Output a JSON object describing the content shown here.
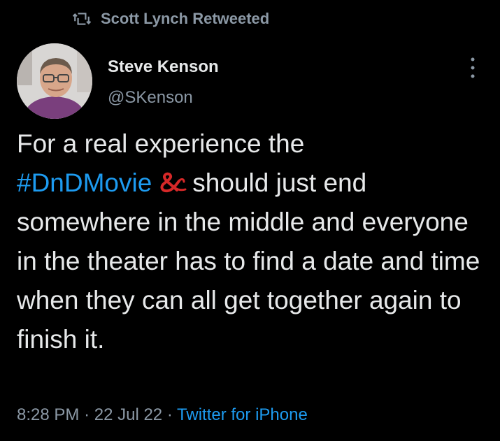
{
  "retweet": {
    "icon": "retweet-icon",
    "label": "Scott Lynch Retweeted"
  },
  "author": {
    "display_name": "Steve Kenson",
    "handle": "@SKenson",
    "avatar_icon": "avatar"
  },
  "menu": {
    "icon": "more-vertical-icon"
  },
  "tweet": {
    "line1": "For a real experience the",
    "hashtag": "#DnDMovie",
    "hashtag_emoji_icon": "dnd-ampersand-icon",
    "after_hashtag": "should just end somewhere in the middle and everyone in the theater has to find a date and time when they can all get together again to finish it."
  },
  "meta": {
    "time": "8:28 PM",
    "sep1": "·",
    "date": "22 Jul 22",
    "sep2": "·",
    "source": "Twitter for iPhone"
  },
  "colors": {
    "background": "#000000",
    "text": "#e7e9ea",
    "secondary": "#8b98a5",
    "link": "#1d9bf0",
    "dnd_red": "#d62828"
  }
}
